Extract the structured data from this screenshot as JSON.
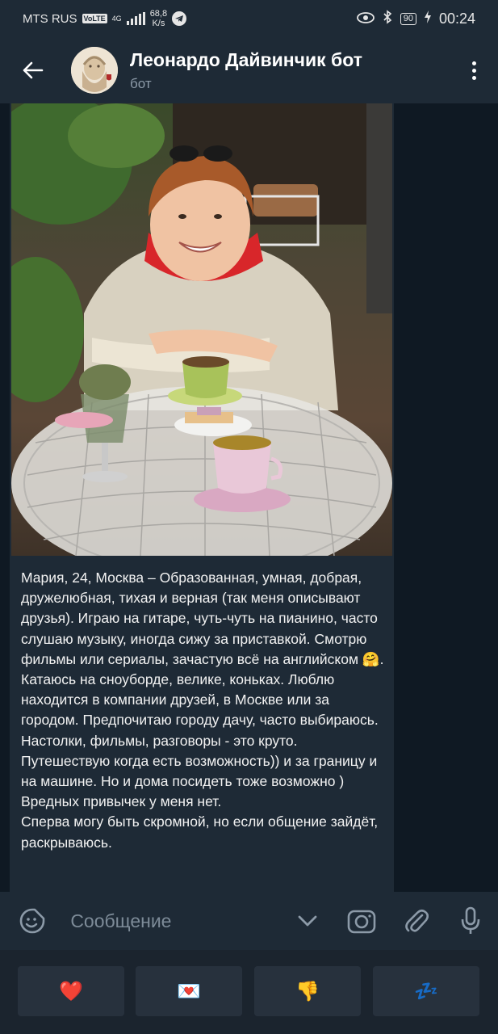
{
  "status_bar": {
    "carrier": "MTS RUS",
    "volte": "VoLTE",
    "network": "4G",
    "speed_value": "68,8",
    "speed_unit": "K/s",
    "battery": "90",
    "time": "00:24"
  },
  "header": {
    "title": "Леонардо Дайвинчик бот",
    "subtitle": "бот"
  },
  "message": {
    "text": "Мария, 24, Москва – Образованная, умная, добрая, дружелюбная, тихая и верная (так меня описывают друзья). Играю на гитаре, чуть-чуть на пианино, часто слушаю музыку, иногда сижу за приставкой. Смотрю фильмы или сериалы, зачастую всё на английском 🤗. Катаюсь на сноуборде, велике, коньках. Люблю находится в компании друзей, в Москве или за городом. Предпочитаю городу дачу, часто выбираюсь. Настолки, фильмы, разговоры - это круто. Путешествую когда есть возможность)) и за границу и на машине. Но и дома посидеть тоже возможно )\nВредных привычек у меня нет.\nСперва могу быть скромной, но если общение зайдёт, раскрываюсь."
  },
  "input": {
    "placeholder": "Сообщение"
  },
  "keyboard": {
    "buttons": [
      "❤️",
      "💌",
      "👎",
      "💤"
    ]
  },
  "colors": {
    "background": "#0f1923",
    "bar": "#1e2a36",
    "accent_text": "#8c9aa8",
    "key_button": "#27313d"
  }
}
